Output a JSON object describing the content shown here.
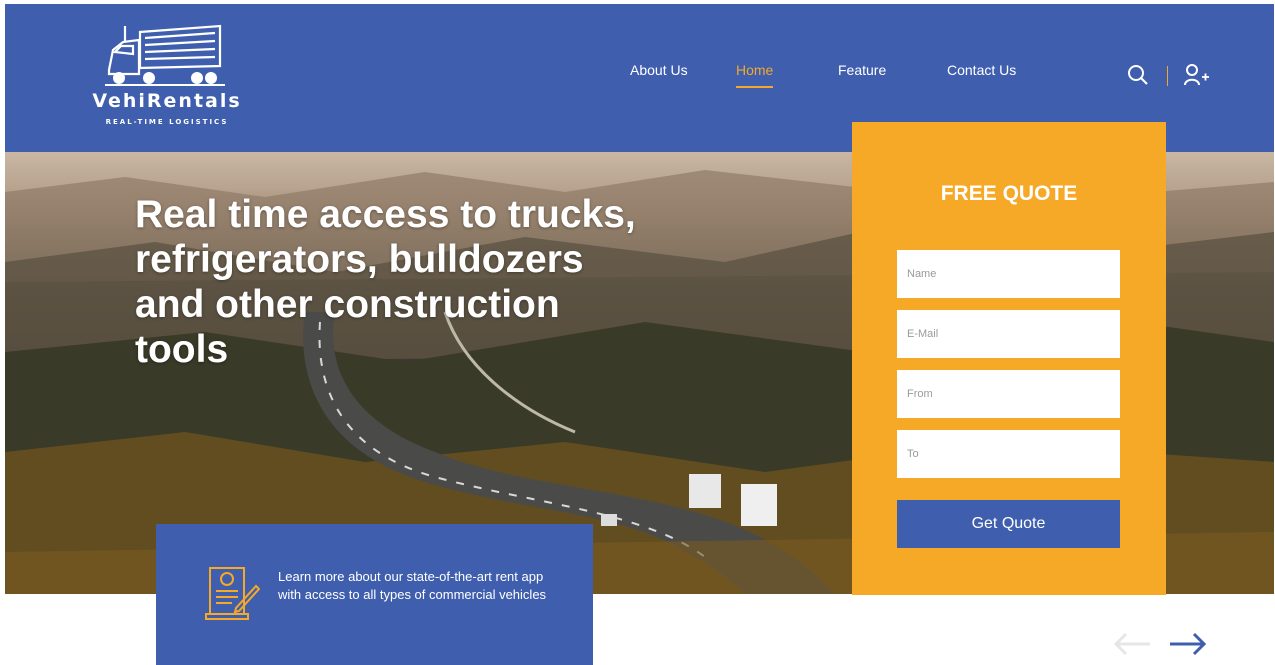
{
  "brand": {
    "name": "VehiRentals",
    "tagline": "REAL-TIME LOGISTICS"
  },
  "nav": {
    "items": [
      "About Us",
      "Home",
      "Feature",
      "Contact Us"
    ],
    "active": "Home"
  },
  "hero": {
    "headline": "Real time access to trucks, refrigerators, bulldozers and other construction tools"
  },
  "quote_form": {
    "title": "FREE QUOTE",
    "fields": [
      {
        "placeholder": "Name"
      },
      {
        "placeholder": "E-Mail"
      },
      {
        "placeholder": "From"
      },
      {
        "placeholder": "To"
      }
    ],
    "submit_label": "Get Quote"
  },
  "info_card": {
    "text": "Learn more about our state-of-the-art rent app with access to all types of commercial vehicles"
  },
  "icons": [
    "truck-logo-icon",
    "search-icon",
    "user-add-icon",
    "document-icon",
    "arrow-left-icon",
    "arrow-right-icon"
  ],
  "colors": {
    "primary": "#3f5fae",
    "accent": "#f6a827",
    "active_nav": "#f2a72e"
  }
}
